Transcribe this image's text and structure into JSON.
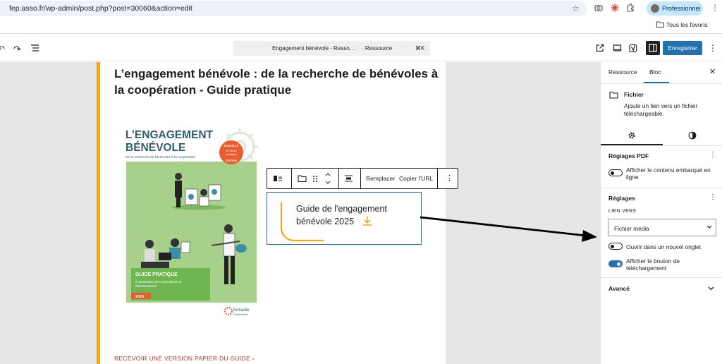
{
  "browser": {
    "url": "fep.asso.fr/wp-admin/post.php?post=30060&action=edit",
    "profile_label": "Professionnel",
    "bookmarks_label": "Tous les favoris"
  },
  "editor_header": {
    "command_title": "Engagement bénévole - Resso…",
    "command_type": "· Ressource",
    "command_shortcut": "⌘K",
    "publish_label": "Enregistrer"
  },
  "canvas": {
    "post_title": "L’engagement bénévole : de la recherche de bénévoles à la coopération - Guide pratique",
    "cover": {
      "heading_1": "L’ENGAGEMENT",
      "heading_2": "BÉNÉVOLE",
      "subtitle": "De la recherche de bénévoles à la coopération",
      "badge_1": "NOUVELLE",
      "badge_2": "35 fiches",
      "badge_3": "pratiques",
      "badge_4": "ÉDITION",
      "guide_label": "GUIDE PRATIQUE",
      "guide_desc_1": "À destination des associations et",
      "guide_desc_2": "établissements",
      "year": "2024",
      "logo_line_1": "Entraide",
      "logo_line_2": "Protestante"
    },
    "block_toolbar": {
      "replace_label": "Remplacer",
      "copy_url_label": "Copier l’URL"
    },
    "file_block": {
      "file_name": "Guide de l'engagement bénévole 2025"
    },
    "cta_link": "RECEVOIR UNE VERSION PAPIER DU GUIDE"
  },
  "sidebar": {
    "tabs": [
      "Ressource",
      "Bloc"
    ],
    "active_tab": "Bloc",
    "block_card": {
      "title": "Fichier",
      "description": "Ajoute un lien vers un fichier téléchargeable."
    },
    "pdf_settings": {
      "heading": "Réglages PDF",
      "embed_label": "Afficher le contenu embarqué en ligne",
      "embed_on": false
    },
    "settings": {
      "heading": "Réglages",
      "link_to_label": "LIEN VERS",
      "link_to_value": "Fichier média",
      "new_tab_label": "Ouvrir dans un nouvel onglet",
      "new_tab_on": false,
      "download_button_label": "Afficher le bouton de téléchargement",
      "download_button_on": true
    },
    "advanced_heading": "Avancé"
  },
  "colors": {
    "accent": "#2271b1",
    "page_border": "#f2a71b",
    "cta": "#c0392b",
    "cover_green": "#a7d08a",
    "cover_title": "#2f5f6e"
  },
  "icons": [
    "undo-icon",
    "redo-icon",
    "list-view-icon",
    "external-link-icon",
    "desktop-preview-icon",
    "yoast-icon",
    "sidebar-toggle-icon",
    "folder-icon",
    "drag-handle-icon",
    "move-arrows-icon",
    "align-icon",
    "download-icon",
    "gear-icon",
    "contrast-icon",
    "chevron-down-icon",
    "close-icon"
  ]
}
